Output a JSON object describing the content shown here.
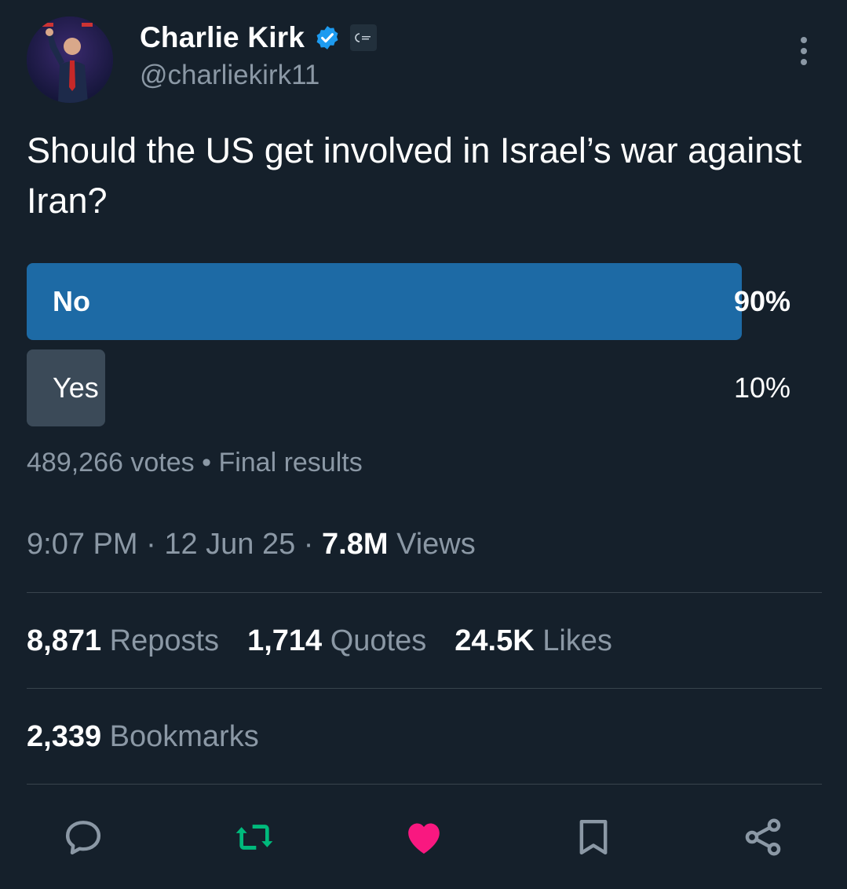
{
  "author": {
    "name": "Charlie Kirk",
    "handle": "@charliekirk11"
  },
  "tweet": {
    "text": "Should the US get involved in Israel’s war against Iran?"
  },
  "poll": {
    "options": [
      {
        "label": "No",
        "percent_text": "90%",
        "percent": 90
      },
      {
        "label": "Yes",
        "percent_text": "10%",
        "percent": 10
      }
    ],
    "votes": "489,266 votes",
    "separator": "•",
    "status": "Final results"
  },
  "meta": {
    "time": "9:07 PM",
    "date": "12 Jun 25",
    "views_count": "7.8M",
    "views_label": "Views"
  },
  "stats": {
    "reposts_count": "8,871",
    "reposts_label": "Reposts",
    "quotes_count": "1,714",
    "quotes_label": "Quotes",
    "likes_count": "24.5K",
    "likes_label": "Likes",
    "bookmarks_count": "2,339",
    "bookmarks_label": "Bookmarks"
  },
  "colors": {
    "background": "#15202b",
    "poll_winner": "#1d6aa5",
    "poll_other": "#3b4a58",
    "muted_text": "#8b98a5",
    "verified": "#1d9bf0",
    "repost_active": "#00ba7c",
    "like_active": "#f91880"
  },
  "icons": {
    "verified": "verified-badge-icon",
    "org": "organization-badge-icon",
    "more": "more-vertical-icon",
    "reply": "reply-icon",
    "repost": "repost-icon",
    "like": "heart-icon",
    "bookmark": "bookmark-icon",
    "share": "share-icon"
  }
}
